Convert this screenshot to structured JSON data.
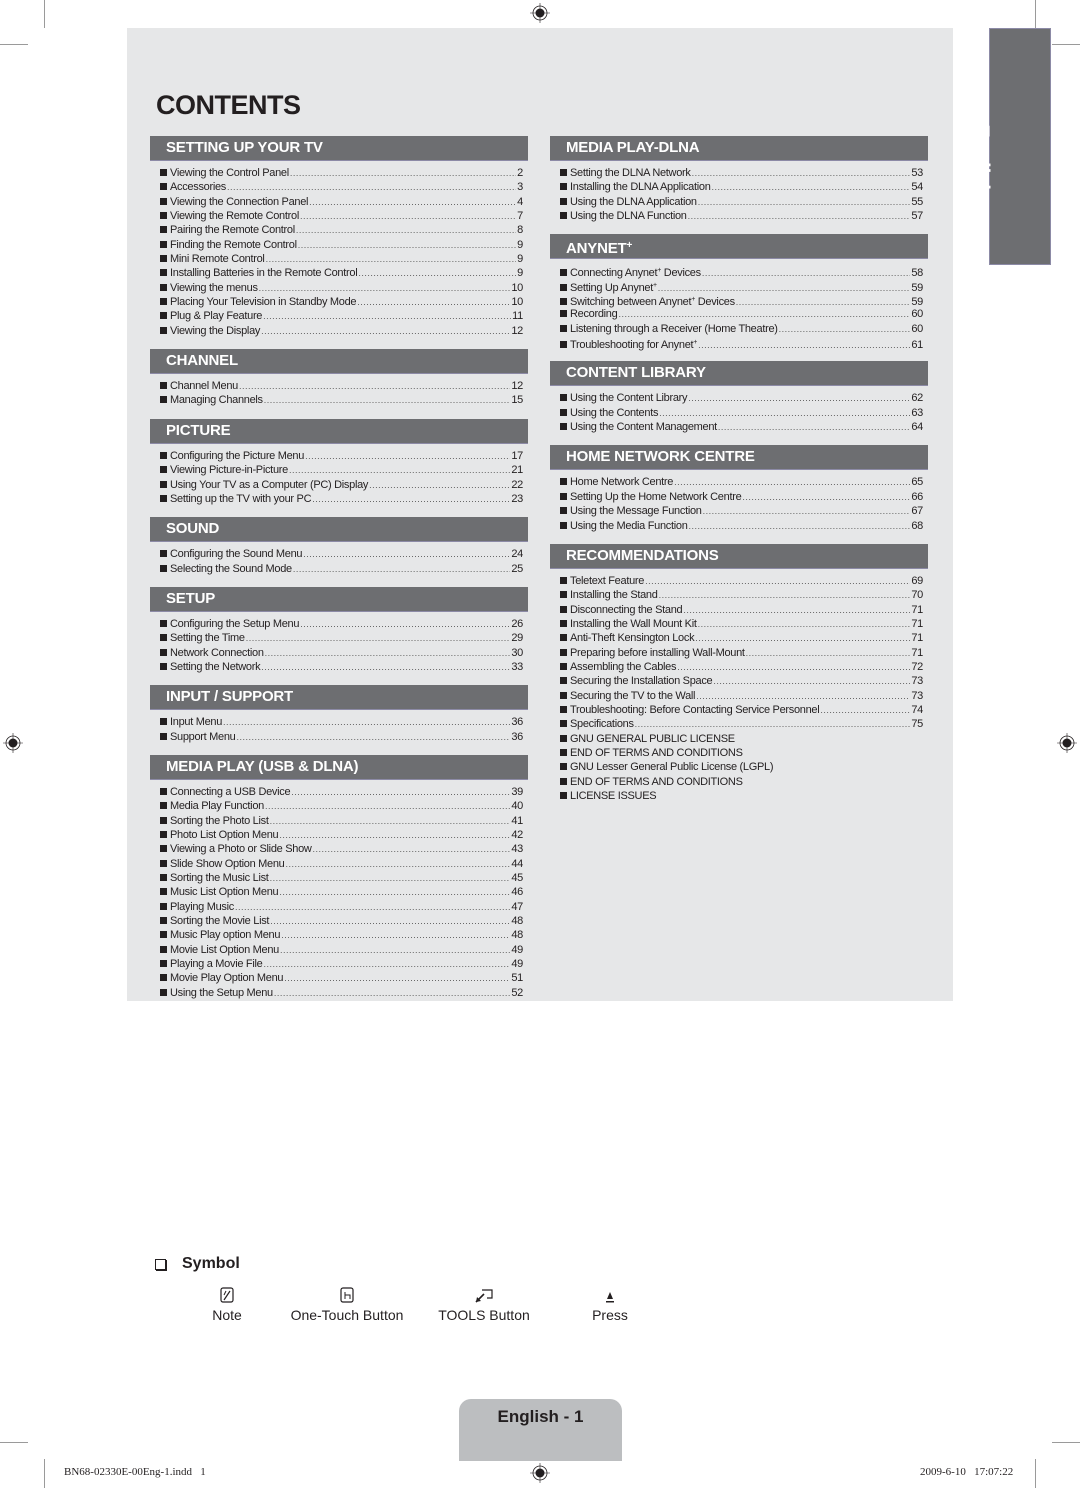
{
  "title": "CONTENTS",
  "language_tab": "English",
  "left_sections": [
    {
      "heading": "SETTING UP YOUR TV",
      "items": [
        {
          "label": "Viewing the Control Panel",
          "page": "2"
        },
        {
          "label": "Accessories",
          "page": "3"
        },
        {
          "label": "Viewing the Connection Panel",
          "page": "4"
        },
        {
          "label": "Viewing the Remote Control",
          "page": "7"
        },
        {
          "label": "Pairing the Remote Control",
          "page": "8"
        },
        {
          "label": "Finding the Remote Control",
          "page": "9"
        },
        {
          "label": "Mini Remote Control",
          "page": "9"
        },
        {
          "label": "Installing Batteries in the Remote Control",
          "page": "9"
        },
        {
          "label": "Viewing the menus",
          "page": "10"
        },
        {
          "label": "Placing Your Television in Standby Mode",
          "page": "10"
        },
        {
          "label": "Plug & Play Feature",
          "page": "11"
        },
        {
          "label": "Viewing the Display",
          "page": "12"
        }
      ]
    },
    {
      "heading": "CHANNEL",
      "items": [
        {
          "label": "Channel Menu",
          "page": "12"
        },
        {
          "label": "Managing Channels",
          "page": "15"
        }
      ]
    },
    {
      "heading": "PICTURE",
      "items": [
        {
          "label": "Configuring the Picture Menu",
          "page": "17"
        },
        {
          "label": "Viewing Picture-in-Picture",
          "page": "21"
        },
        {
          "label": "Using Your TV as a Computer (PC) Display",
          "page": "22"
        },
        {
          "label": "Setting up the TV with your PC",
          "page": "23"
        }
      ]
    },
    {
      "heading": "SOUND",
      "items": [
        {
          "label": "Configuring the Sound Menu",
          "page": "24"
        },
        {
          "label": "Selecting the Sound Mode",
          "page": "25"
        }
      ]
    },
    {
      "heading": "SETUP",
      "items": [
        {
          "label": "Configuring the Setup Menu",
          "page": "26"
        },
        {
          "label": "Setting the Time",
          "page": "29"
        },
        {
          "label": "Network Connection",
          "page": "30"
        },
        {
          "label": "Setting the Network",
          "page": "33"
        }
      ]
    },
    {
      "heading": "INPUT / SUPPORT",
      "items": [
        {
          "label": "Input Menu",
          "page": "36"
        },
        {
          "label": "Support Menu",
          "page": "36"
        }
      ]
    },
    {
      "heading": "MEDIA PLAY (USB & DLNA)",
      "items": [
        {
          "label": "Connecting a USB Device",
          "page": "39"
        },
        {
          "label": "Media Play Function",
          "page": "40"
        },
        {
          "label": "Sorting the Photo List",
          "page": "41"
        },
        {
          "label": "Photo List Option Menu",
          "page": "42"
        },
        {
          "label": "Viewing a Photo or Slide Show",
          "page": "43"
        },
        {
          "label": "Slide Show Option Menu",
          "page": "44"
        },
        {
          "label": "Sorting the Music List",
          "page": "45"
        },
        {
          "label": "Music List Option Menu",
          "page": "46"
        },
        {
          "label": "Playing Music",
          "page": "47"
        },
        {
          "label": "Sorting the Movie List",
          "page": "48"
        },
        {
          "label": "Music Play option Menu",
          "page": "48"
        },
        {
          "label": "Movie List Option Menu",
          "page": "49"
        },
        {
          "label": "Playing a Movie File",
          "page": "49"
        },
        {
          "label": "Movie Play Option Menu",
          "page": "51"
        },
        {
          "label": "Using the Setup Menu",
          "page": "52"
        }
      ]
    }
  ],
  "right_sections": [
    {
      "heading": "MEDIA PLAY-DLNA",
      "items": [
        {
          "label": "Setting the DLNA Network",
          "page": "53"
        },
        {
          "label": "Installing the DLNA Application",
          "page": "54"
        },
        {
          "label": "Using the DLNA Application",
          "page": "55"
        },
        {
          "label": "Using the DLNA Function",
          "page": "57"
        }
      ]
    },
    {
      "heading": "ANYNET",
      "heading_sup": "+",
      "items": [
        {
          "label": "Connecting Anynet",
          "sup": "+",
          "label_after": " Devices",
          "page": "58"
        },
        {
          "label": "Setting Up Anynet",
          "sup": "+",
          "page": "59"
        },
        {
          "label": "Switching between Anynet",
          "sup": "+",
          "label_after": " Devices",
          "page": "59"
        },
        {
          "label": "Recording",
          "page": "60"
        },
        {
          "label": "Listening through a Receiver (Home Theatre)",
          "page": "60"
        },
        {
          "label": "Troubleshooting for Anynet",
          "sup": "+",
          "page": "61"
        }
      ]
    },
    {
      "heading": "CONTENT LIBRARY",
      "items": [
        {
          "label": "Using the Content Library",
          "page": "62"
        },
        {
          "label": "Using the Contents",
          "page": "63"
        },
        {
          "label": "Using the Content Management",
          "page": "64"
        }
      ]
    },
    {
      "heading": "HOME NETWORK CENTRE",
      "items": [
        {
          "label": "Home Network Centre",
          "page": "65"
        },
        {
          "label": "Setting Up the Home Network Centre",
          "page": "66"
        },
        {
          "label": "Using the Message Function",
          "page": "67"
        },
        {
          "label": "Using the Media Function",
          "page": "68"
        }
      ]
    },
    {
      "heading": "RECOMMENDATIONS",
      "items": [
        {
          "label": "Teletext Feature",
          "page": "69"
        },
        {
          "label": "Installing the Stand",
          "page": "70"
        },
        {
          "label": "Disconnecting the Stand",
          "page": "71"
        },
        {
          "label": "Installing the Wall Mount Kit",
          "page": "71"
        },
        {
          "label": "Anti-Theft Kensington Lock",
          "page": "71"
        },
        {
          "label": "Preparing before installing Wall-Mount",
          "page": "71"
        },
        {
          "label": "Assembling the Cables",
          "page": "72"
        },
        {
          "label": "Securing the Installation Space",
          "page": "73"
        },
        {
          "label": "Securing the TV to the Wall",
          "page": "73"
        },
        {
          "label": "Troubleshooting: Before Contacting Service Personnel",
          "page": "74"
        },
        {
          "label": "Specifications",
          "page": "75"
        },
        {
          "label": "GNU GENERAL PUBLIC LICENSE"
        },
        {
          "label": "END OF TERMS AND CONDITIONS"
        },
        {
          "label": "GNU Lesser General Public License (LGPL)"
        },
        {
          "label": "END OF TERMS AND CONDITIONS"
        },
        {
          "label": "LICENSE ISSUES"
        }
      ]
    }
  ],
  "symbol": {
    "heading": "Symbol",
    "items": [
      {
        "icon": "note-icon",
        "label": "Note"
      },
      {
        "icon": "one-touch-icon",
        "label": "One-Touch Button"
      },
      {
        "icon": "tools-icon",
        "label": "TOOLS Button"
      },
      {
        "icon": "press-icon",
        "label": "Press"
      }
    ]
  },
  "page_label": "English - 1",
  "footer": {
    "file": "BN68-02330E-00Eng-1.indd   1",
    "timestamp": "2009-6-10   17:07:22"
  },
  "colors": {
    "panel_bg": "#e6e7e8",
    "section_header": "#6d6e71",
    "page_tab": "#bcbec0",
    "text": "#231f20"
  }
}
